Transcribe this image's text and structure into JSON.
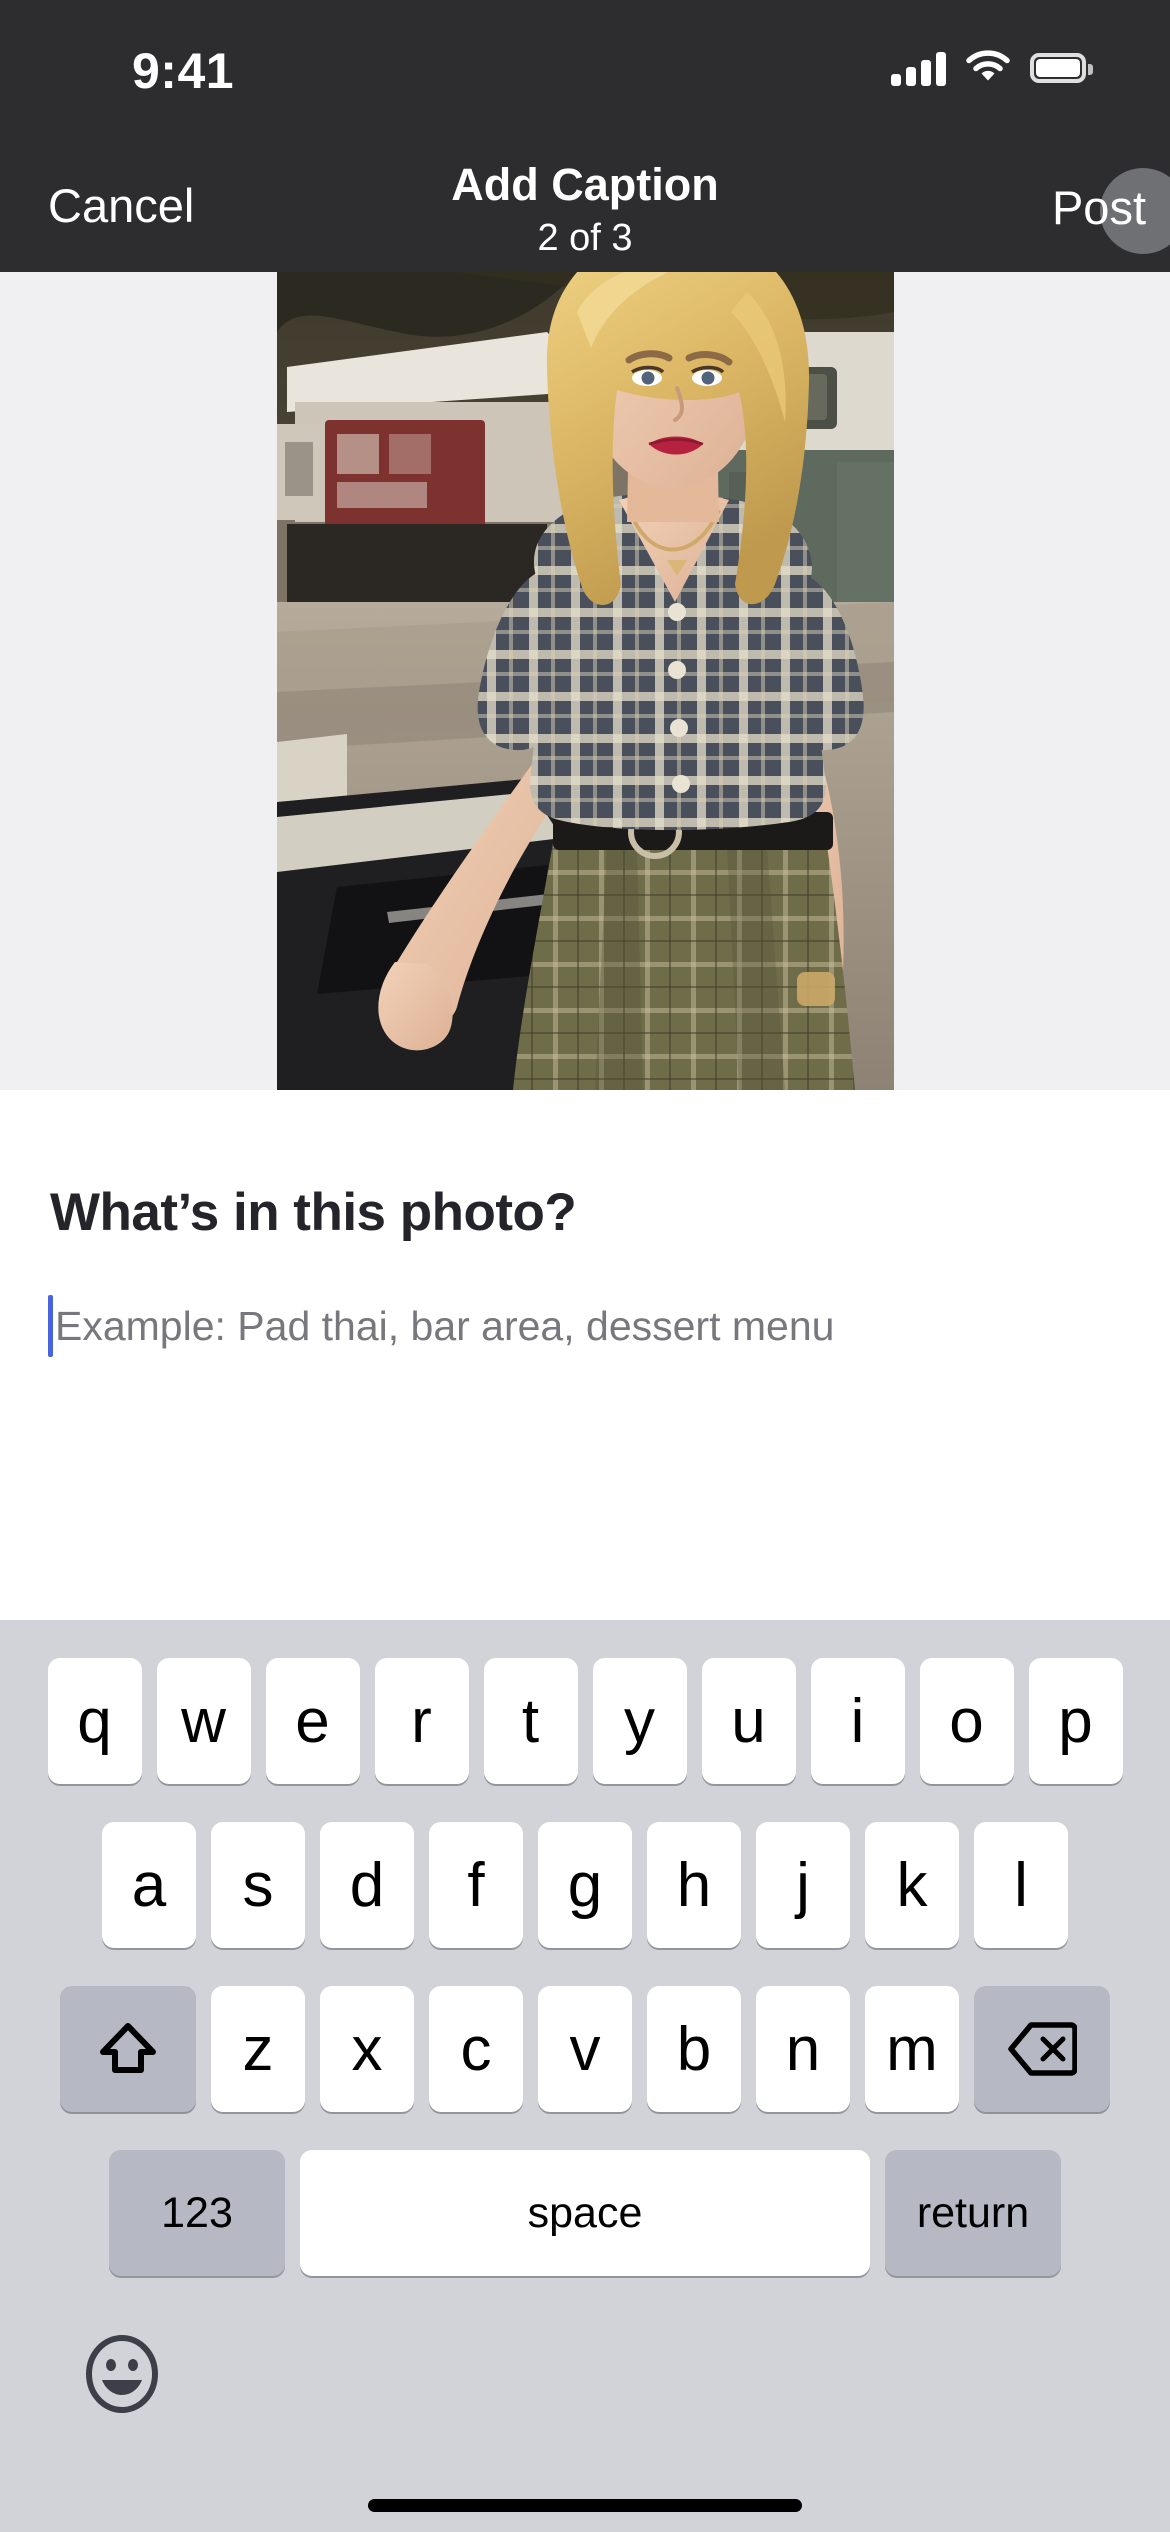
{
  "status_bar": {
    "time": "9:41",
    "signal_icon": "cellular-signal-icon",
    "wifi_icon": "wifi-icon",
    "battery_icon": "battery-full-icon"
  },
  "nav_bar": {
    "cancel_label": "Cancel",
    "title": "Add Caption",
    "subtitle": "2 of 3",
    "post_label": "Post",
    "background_color": "#2d2d2f"
  },
  "photo": {
    "alt": "Blonde woman in plaid crop shirt and olive plaid skirt leaning on a car",
    "background_color": "#f0eff1"
  },
  "caption": {
    "heading": "What’s in this photo?",
    "placeholder": "Example: Pad thai, bar area, dessert menu",
    "value": "",
    "caret_color": "#4a63df"
  },
  "keyboard": {
    "background_color": "#d1d3d9",
    "row1": [
      "q",
      "w",
      "e",
      "r",
      "t",
      "y",
      "u",
      "i",
      "o",
      "p"
    ],
    "row2": [
      "a",
      "s",
      "d",
      "f",
      "g",
      "h",
      "j",
      "k",
      "l"
    ],
    "row3_letters": [
      "z",
      "x",
      "c",
      "v",
      "b",
      "n",
      "m"
    ],
    "shift_icon": "shift-arrow-up-icon",
    "delete_icon": "backspace-delete-icon",
    "numeric_label": "123",
    "space_label": "space",
    "return_label": "return",
    "emoji_icon": "emoji-smiley-icon"
  },
  "home_indicator": {
    "color": "#000000"
  }
}
